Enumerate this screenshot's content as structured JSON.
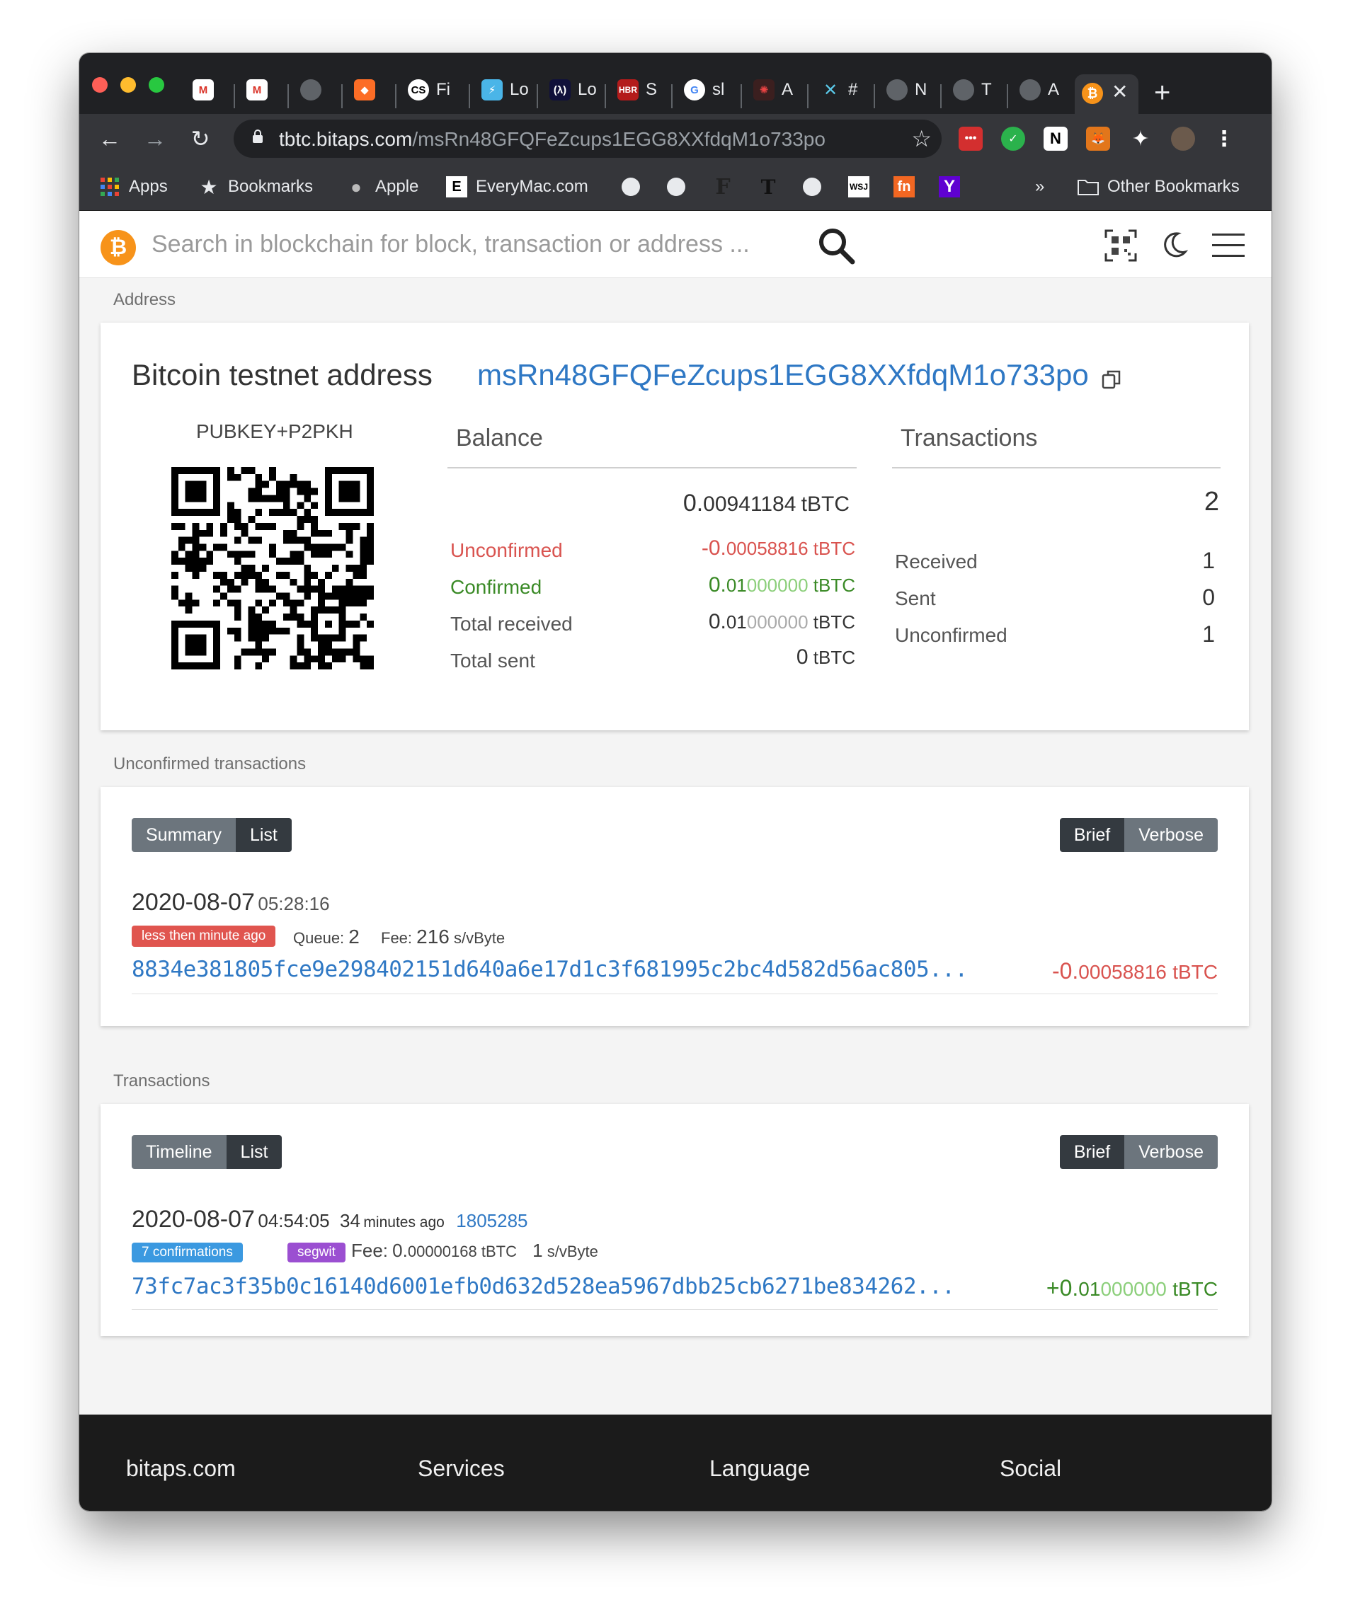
{
  "browser": {
    "tabs": [
      {
        "title": "",
        "icon": "gmail-icon"
      },
      {
        "title": "",
        "icon": "gmail-icon"
      },
      {
        "title": "",
        "icon": "globe-icon"
      },
      {
        "title": "",
        "icon": "gitlab-icon"
      },
      {
        "title": "Fi",
        "icon": "cs-icon"
      },
      {
        "title": "Lo",
        "icon": "lightning-icon"
      },
      {
        "title": "Lo",
        "icon": "code-icon"
      },
      {
        "title": "S",
        "icon": "hbr-icon"
      },
      {
        "title": "sl",
        "icon": "google-icon"
      },
      {
        "title": "A",
        "icon": "openai-icon"
      },
      {
        "title": "#",
        "icon": "confluence-icon"
      },
      {
        "title": "N",
        "icon": "globe-icon"
      },
      {
        "title": "T",
        "icon": "globe-icon"
      },
      {
        "title": "A",
        "icon": "globe-icon"
      }
    ],
    "active_tab_icon": "bitcoin-icon",
    "url_host": "tbtc.bitaps.com",
    "url_path": "/msRn48GFQFeZcups1EGG8XXfdqM1o733po",
    "bookmarks": {
      "apps": "Apps",
      "bookmarks": "Bookmarks",
      "apple": "Apple",
      "everymac": "EveryMac.com",
      "overflow": "»",
      "other": "Other Bookmarks"
    }
  },
  "search": {
    "placeholder": "Search in blockchain for block, transaction or address ..."
  },
  "address_section": {
    "label": "Address",
    "title": "Bitcoin testnet address",
    "address": "msRn48GFQFeZcups1EGG8XXfdqM1o733po",
    "type": "PUBKEY+P2PKH",
    "balance": {
      "heading": "Balance",
      "total_int": "0.",
      "total_frac": "00941184",
      "unit": "tBTC",
      "rows": [
        {
          "label": "Unconfirmed",
          "int": "-0.",
          "frac": "00058816",
          "frac_grey": "",
          "unit": "tBTC"
        },
        {
          "label": "Confirmed",
          "int": "0.",
          "frac": "01",
          "frac_grey": "000000",
          "unit": "tBTC"
        },
        {
          "label": "Total received",
          "int": "0.",
          "frac": "01",
          "frac_grey": "000000",
          "unit": "tBTC"
        },
        {
          "label": "Total sent",
          "int": "0",
          "frac": "",
          "frac_grey": "",
          "unit": "tBTC"
        }
      ]
    },
    "transactions": {
      "heading": "Transactions",
      "total": "2",
      "rows": [
        {
          "label": "Received",
          "value": "1"
        },
        {
          "label": "Sent",
          "value": "0"
        },
        {
          "label": "Unconfirmed",
          "value": "1"
        }
      ]
    }
  },
  "unconfirmed_section": {
    "label": "Unconfirmed transactions",
    "view_buttons": [
      "Summary",
      "List"
    ],
    "mode_buttons": [
      "Brief",
      "Verbose"
    ],
    "tx": {
      "date": "2020-08-07",
      "time": "05:28:16",
      "badge": "less then minute ago",
      "queue_label": "Queue:",
      "queue_value": "2",
      "fee_label": "Fee:",
      "fee_value": "216",
      "fee_unit": "s/vByte",
      "hash": "8834e381805fce9e298402151d640a6e17d1c3f681995c2bc4d582d56ac805...",
      "amount_int": "-0.",
      "amount_frac": "00058816",
      "amount_unit": "tBTC"
    }
  },
  "transactions_section": {
    "label": "Transactions",
    "view_buttons": [
      "Timeline",
      "List"
    ],
    "mode_buttons": [
      "Brief",
      "Verbose"
    ],
    "tx": {
      "date": "2020-08-07",
      "time": "04:54:05",
      "ago_num": "34",
      "ago_text": "minutes ago",
      "block": "1805285",
      "badge_confirmations": "7 confirmations",
      "badge_segwit": "segwit",
      "fee_label": "Fee:",
      "fee_int": "0.",
      "fee_frac": "00000168",
      "fee_unit": "tBTC",
      "rate_value": "1",
      "rate_unit": "s/vByte",
      "hash": "73fc7ac3f35b0c16140d6001efb0d632d528ea5967dbb25cb6271be834262...",
      "amount_int": "+0.",
      "amount_frac": "01",
      "amount_frac_grey": "000000",
      "amount_unit": "tBTC"
    }
  },
  "footer": {
    "site": "bitaps.com",
    "services": "Services",
    "language": "Language",
    "social": "Social"
  },
  "colors": {
    "link": "#2f78c4",
    "negative": "#d9534f",
    "positive": "#3a8a26",
    "bitcoin": "#f7931a",
    "badge_red": "#e0554f",
    "badge_blue": "#3b99e0",
    "badge_purple": "#9b4fd1"
  }
}
